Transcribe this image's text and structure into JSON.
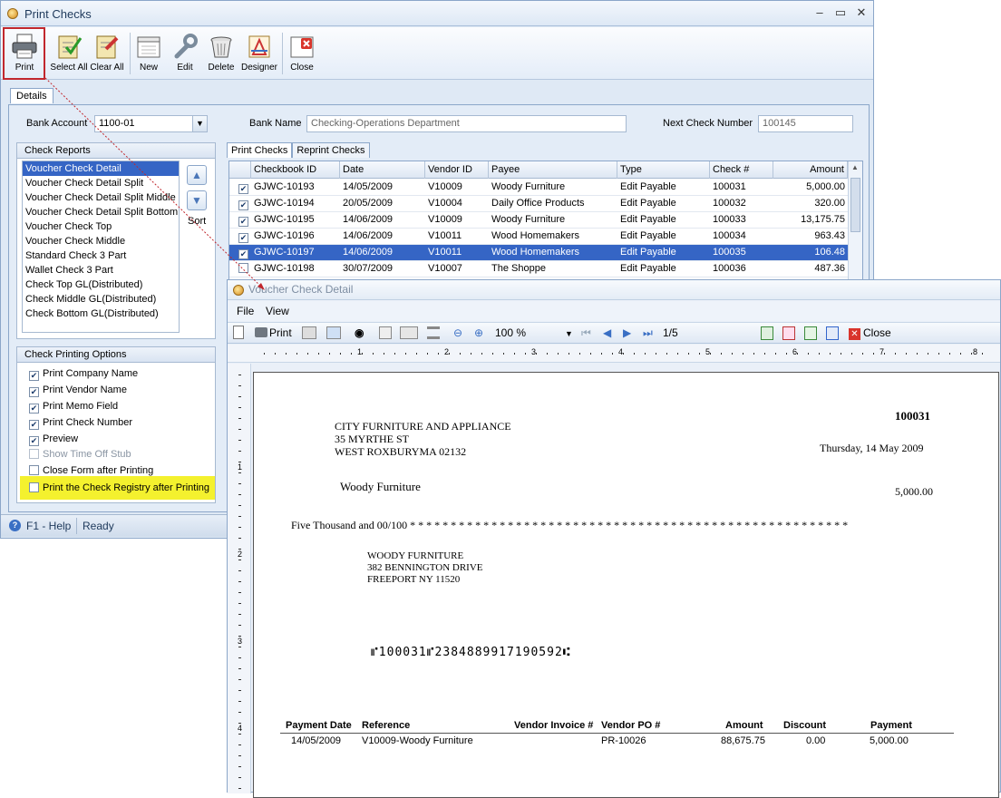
{
  "window": {
    "title": "Print Checks",
    "minimize": "–",
    "maximize": "▭",
    "close": "✕"
  },
  "toolbar": {
    "print": "Print",
    "select_all": "Select All",
    "clear_all": "Clear All",
    "new": "New",
    "edit": "Edit",
    "delete": "Delete",
    "designer": "Designer",
    "close": "Close"
  },
  "details_tab": "Details",
  "bank_account": {
    "label": "Bank Account",
    "value": "1100-01"
  },
  "bank_name": {
    "label": "Bank Name",
    "value": "Checking-Operations Department"
  },
  "next_check": {
    "label": "Next Check Number",
    "value": "100145"
  },
  "check_reports": {
    "title": "Check Reports",
    "items": [
      "Voucher Check Detail",
      "Voucher Check Detail Split",
      "Voucher Check Detail Split Middle",
      "Voucher Check Detail Split Bottom",
      "Voucher Check Top",
      "Voucher Check Middle",
      "Standard Check 3 Part",
      "Wallet Check 3 Part",
      "Check Top GL(Distributed)",
      "Check Middle GL(Distributed)",
      "Check Bottom GL(Distributed)"
    ],
    "selected_index": 0,
    "sort_label": "Sort"
  },
  "print_options": {
    "title": "Check Printing Options",
    "items": [
      {
        "label": "Print Company Name",
        "checked": true,
        "disabled": false
      },
      {
        "label": "Print Vendor Name",
        "checked": true,
        "disabled": false
      },
      {
        "label": "Print Memo Field",
        "checked": true,
        "disabled": false
      },
      {
        "label": "Print Check Number",
        "checked": true,
        "disabled": false
      },
      {
        "label": "Preview",
        "checked": true,
        "disabled": false
      },
      {
        "label": "Show Time Off Stub",
        "checked": false,
        "disabled": true
      },
      {
        "label": "Close Form after Printing",
        "checked": false,
        "disabled": false
      },
      {
        "label": "Print the Check Registry after Printing",
        "checked": false,
        "disabled": false
      }
    ]
  },
  "status": {
    "help": "F1 - Help",
    "state": "Ready"
  },
  "grid_tabs": [
    "Print Checks",
    "Reprint Checks"
  ],
  "grid": {
    "columns": [
      "Checkbook ID",
      "Date",
      "Vendor ID",
      "Payee",
      "Type",
      "Check #",
      "Amount"
    ],
    "rows": [
      {
        "checked": true,
        "id": "GJWC-10193",
        "date": "14/05/2009",
        "vendor": "V10009",
        "payee": "Woody Furniture",
        "type": "Edit Payable",
        "check": "100031",
        "amount": "5,000.00"
      },
      {
        "checked": true,
        "id": "GJWC-10194",
        "date": "20/05/2009",
        "vendor": "V10004",
        "payee": "Daily Office Products",
        "type": "Edit Payable",
        "check": "100032",
        "amount": "320.00"
      },
      {
        "checked": true,
        "id": "GJWC-10195",
        "date": "14/06/2009",
        "vendor": "V10009",
        "payee": "Woody Furniture",
        "type": "Edit Payable",
        "check": "100033",
        "amount": "13,175.75"
      },
      {
        "checked": true,
        "id": "GJWC-10196",
        "date": "14/06/2009",
        "vendor": "V10011",
        "payee": "Wood Homemakers",
        "type": "Edit Payable",
        "check": "100034",
        "amount": "963.43"
      },
      {
        "checked": true,
        "id": "GJWC-10197",
        "date": "14/06/2009",
        "vendor": "V10011",
        "payee": "Wood Homemakers",
        "type": "Edit Payable",
        "check": "100035",
        "amount": "106.48"
      },
      {
        "checked": false,
        "id": "GJWC-10198",
        "date": "30/07/2009",
        "vendor": "V10007",
        "payee": "The Shoppe",
        "type": "Edit Payable",
        "check": "100036",
        "amount": "487.36"
      }
    ],
    "selected_index": 4
  },
  "preview": {
    "title": "Voucher Check Detail",
    "menu": [
      "File",
      "View"
    ],
    "print": "Print",
    "zoom": "100 %",
    "page": "1/5",
    "close": "Close",
    "ruler_h": [
      "1",
      "2",
      "3",
      "4",
      "5",
      "6",
      "7",
      "8"
    ],
    "ruler_v": [
      "1",
      "2",
      "3",
      "4"
    ]
  },
  "check": {
    "number": "100031",
    "company": [
      "CITY FURNITURE AND APPLIANCE",
      "35 MYRTHE ST",
      "WEST ROXBURYMA 02132"
    ],
    "date": "Thursday, 14 May 2009",
    "payee": "Woody Furniture",
    "amount": "5,000.00",
    "words": "Five Thousand and 00/100 * * * * * * * * * * * * * * * * * * * * * * * * * * * * * * * * * * * * * * * * * * * * * * * * * * * * * *",
    "address": [
      "WOODY FURNITURE",
      "382 BENNINGTON DRIVE",
      "FREEPORT NY 11520"
    ],
    "micr": "⑈100031⑈2384889917190592⑆",
    "stub_headers": [
      "Payment Date",
      "Reference",
      "Vendor Invoice #",
      "Vendor PO #",
      "Amount",
      "Discount",
      "Payment"
    ],
    "stub_row": [
      "14/05/2009",
      "V10009-Woody Furniture",
      "",
      "PR-10026",
      "88,675.75",
      "0.00",
      "5,000.00"
    ]
  },
  "colors": {
    "selection": "#3565c5",
    "highlight": "#f4f12e",
    "print_border": "#c1272d"
  }
}
